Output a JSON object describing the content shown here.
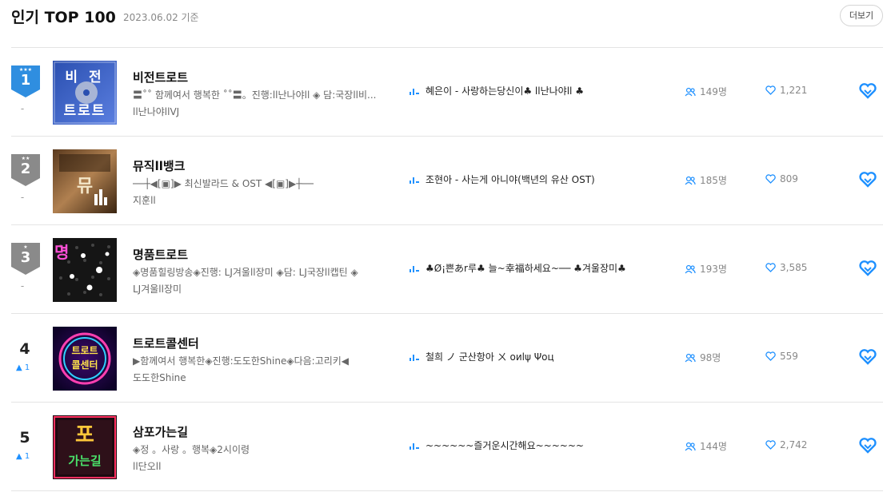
{
  "header": {
    "title": "인기 TOP 100",
    "date": "2023.06.02 기준",
    "more_label": "더보기"
  },
  "colors": {
    "accent": "#1e90ff",
    "gold": "#2f8ee0",
    "gray_badge": "#8a8a8a"
  },
  "rows": [
    {
      "rank": "1",
      "stars": "★★★",
      "change": "-",
      "name": "비전트로트",
      "desc1": "〓˚˚ 함께여서 행복한 ˚˚〓。진행:ll난나야ll ◈ 담:국장ll비...",
      "desc2": "ll난나야llVJ",
      "song": "혜은이 - 사랑하는당신이♣ ll난나야ll ♣",
      "listeners": "149명",
      "likes": "1,221",
      "thumb": {
        "line1": "비  전",
        "line2": "트로트"
      }
    },
    {
      "rank": "2",
      "stars": "★★",
      "change": "-",
      "name": "뮤직ll뱅크",
      "desc1": "──┼◀[▣]▶ 최신발라드 & OST ◀[▣]▶┼──",
      "desc2": "지훈ll",
      "song": "조현아 - 사는게 아니야(백년의 유산 OST)",
      "listeners": "185명",
      "likes": "809",
      "thumb": {
        "line1": "뮤"
      }
    },
    {
      "rank": "3",
      "stars": "★",
      "change": "-",
      "name": "명품트로트",
      "desc1": "◈명품힐링방송◈진행: LJ겨울ll장미 ◈담: LJ국장ll캡틴 ◈",
      "desc2": "LJ겨울ll장미",
      "song": "♣Ø¡쁜あr루♣ 늘~幸福하세요~── ♣겨울장미♣",
      "listeners": "193명",
      "likes": "3,585",
      "thumb": {
        "line1": "명"
      }
    },
    {
      "rank": "4",
      "up": "1",
      "name": "트로트콜센터",
      "desc1": "▶함께여서 행복한◈진행:도도한Shine◈다음:고리키◀",
      "desc2": "도도한Shine",
      "song": "철희 ノ 군산항아 ㄨ оиlψ Ψоц",
      "listeners": "98명",
      "likes": "559",
      "thumb": {
        "line1": "트로트",
        "line2": "콜센터"
      }
    },
    {
      "rank": "5",
      "up": "1",
      "name": "삼포가는길",
      "desc1": "◈정 。사랑 。행복◈2시이령",
      "desc2": "ll단오ll",
      "song": "~~~~~~즐거운시간해요~~~~~~",
      "listeners": "144명",
      "likes": "2,742",
      "thumb": {
        "line1": "포",
        "line2": "가는길"
      }
    }
  ]
}
